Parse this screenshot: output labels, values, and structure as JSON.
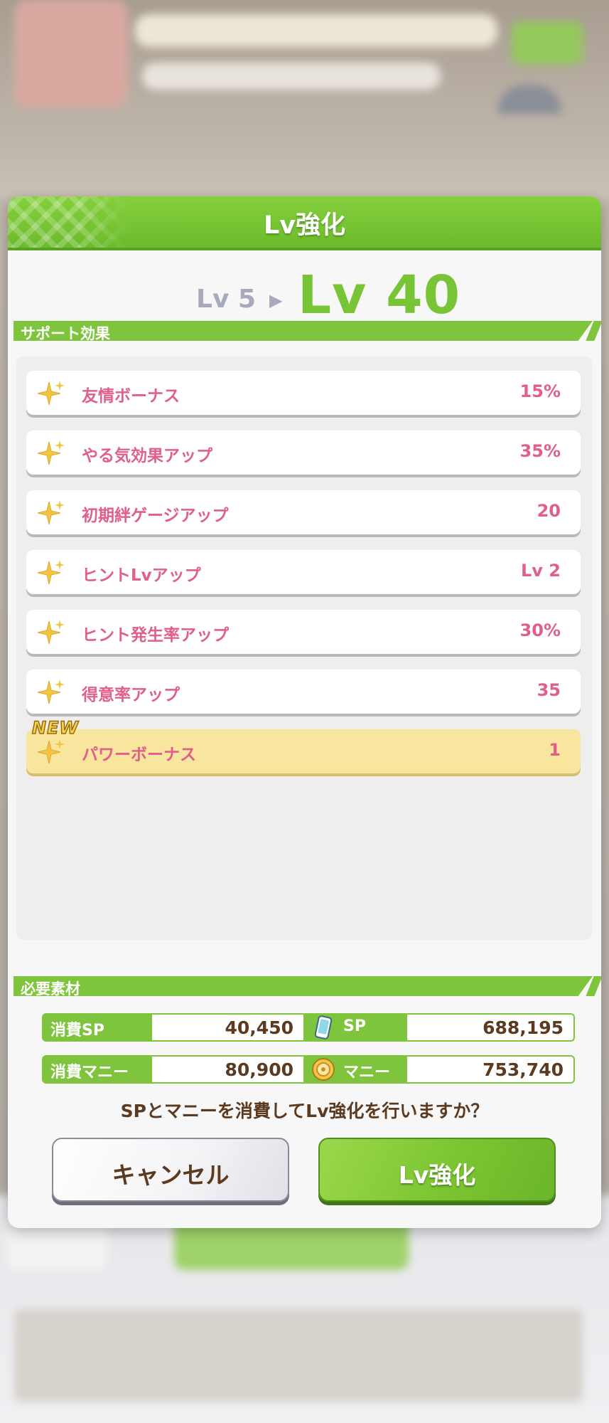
{
  "dialog": {
    "title": "Lv強化",
    "level_from": "Lv 5",
    "level_to": "Lv 40"
  },
  "support_effects": {
    "heading": "サポート効果",
    "items": [
      {
        "name": "友情ボーナス",
        "value": "15%",
        "is_new": false
      },
      {
        "name": "やる気効果アップ",
        "value": "35%",
        "is_new": false
      },
      {
        "name": "初期絆ゲージアップ",
        "value": "20",
        "is_new": false
      },
      {
        "name": "ヒントLvアップ",
        "value": "Lv 2",
        "is_new": false
      },
      {
        "name": "ヒント発生率アップ",
        "value": "30%",
        "is_new": false
      },
      {
        "name": "得意率アップ",
        "value": "35",
        "is_new": false
      },
      {
        "name": "パワーボーナス",
        "value": "1",
        "is_new": true
      }
    ],
    "new_badge": "NEW"
  },
  "materials": {
    "heading": "必要素材",
    "rows": [
      {
        "cost_label": "消費SP",
        "cost_value": "40,450",
        "owned_label": "SP",
        "owned_value": "688,195",
        "owned_icon": "phone-icon"
      },
      {
        "cost_label": "消費マニー",
        "cost_value": "80,900",
        "owned_label": "マニー",
        "owned_value": "753,740",
        "owned_icon": "coin-icon"
      }
    ]
  },
  "confirm_text": "SPとマニーを消費してLv強化を行いますか？",
  "buttons": {
    "cancel_label": "キャンセル",
    "confirm_label": "Lv強化"
  },
  "colors": {
    "accent_green": "#7ec43c",
    "effect_text": "#e05f8c",
    "new_row": "#f8e59e"
  }
}
